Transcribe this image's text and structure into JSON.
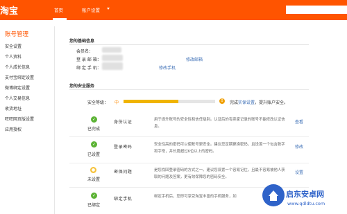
{
  "topbar": {
    "logo": "淘宝",
    "nav_home": "首页",
    "nav_account": "账户设置",
    "accent_color": "#ff5400"
  },
  "sidebar": {
    "title": "账号管理",
    "items": [
      {
        "label": "安全设置"
      },
      {
        "label": "个人资料"
      },
      {
        "label": "个人成长信息"
      },
      {
        "label": "支付宝绑定设置"
      },
      {
        "label": "微博绑定设置"
      },
      {
        "label": "个人交易信息"
      },
      {
        "label": "收货地址"
      },
      {
        "label": "旺旺网页版设置"
      },
      {
        "label": "应用授权"
      }
    ]
  },
  "basic_info": {
    "title": "您的基础信息",
    "member_label": "会员名：",
    "email_label": "登 录 邮 箱：",
    "phone_label": "绑 定 手 机：",
    "edit_email": "修改邮箱",
    "edit_phone": "修改手机"
  },
  "security": {
    "title": "您的安全服务",
    "level_label": "安全等级：",
    "level_value": "中",
    "level_progress": 0.6,
    "level_tip_before": "完成",
    "level_tip_link": "实保设置",
    "level_tip_after": "，提升账户安全。",
    "rows": [
      {
        "icon": "check-icon",
        "status": "已完成",
        "name": "身份认证",
        "desc": "用于提升账号的安全性和信任级别。认证后的有卖家记录的账号不能修改认证信息。",
        "action": "查看"
      },
      {
        "icon": "check-icon",
        "status": "已设置",
        "name": "登录密码",
        "desc": "安全性高的密码可以使账号更安全。建议您定期更换密码，且设置一个包含数字和字母，并长度超过6位以上的密码。",
        "action": "修改"
      },
      {
        "icon": "bulb-icon",
        "status": "未设置",
        "name": "密保问题",
        "desc": "是您找回登录密码的方式之一。建议您设置一个容易记住，且最不容易被他人获取的问题及答案，更有效保障您的密码安全。",
        "action": "设置"
      },
      {
        "icon": "check-icon",
        "status": "已绑定",
        "name": "绑定手机",
        "desc": "绑定手机后，您即可享受淘宝丰富的手机服务，如",
        "action": ""
      }
    ]
  },
  "watermark": {
    "title": "启东安卓网",
    "url": "www.qdldtu.com"
  }
}
